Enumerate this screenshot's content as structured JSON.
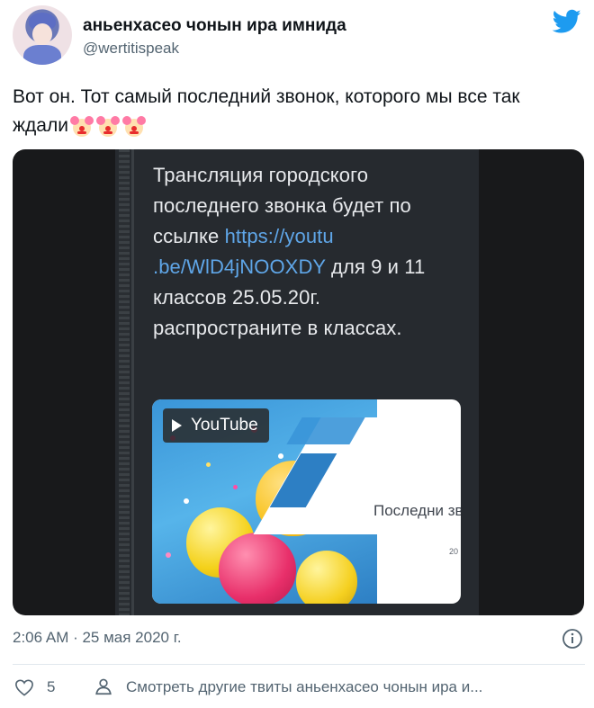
{
  "user": {
    "display_name": "аньенхасео чонын ира имнида",
    "handle": "@wertitispeak"
  },
  "tweet": {
    "text": "Вот он. Тот самый последний звонок, которого мы все так ждали",
    "emoji_icons": [
      "clown-face-icon",
      "clown-face-icon",
      "clown-face-icon"
    ]
  },
  "media": {
    "message_text_before_link": "Трансляция городского последнего звонка будет по ссылке ",
    "message_link": "https://youtu .be/WlD4jNOOXDY",
    "message_text_after_link": " для 9 и 11 классов 25.05.20г. распространите в классах.",
    "card_badge": "YouTube",
    "card_title": "Последни звоно",
    "card_subtitle": "20"
  },
  "footer": {
    "timestamp": "2:06 AM · 25 мая 2020 г.",
    "like_count": "5",
    "more_tweets": "Смотреть другие твиты аньенхасео чонын ира и..."
  },
  "colors": {
    "twitter_blue": "#1d9bf0",
    "link_blue": "#5fa6e8",
    "secondary_text": "#536471",
    "divider": "#e1e8ed"
  }
}
